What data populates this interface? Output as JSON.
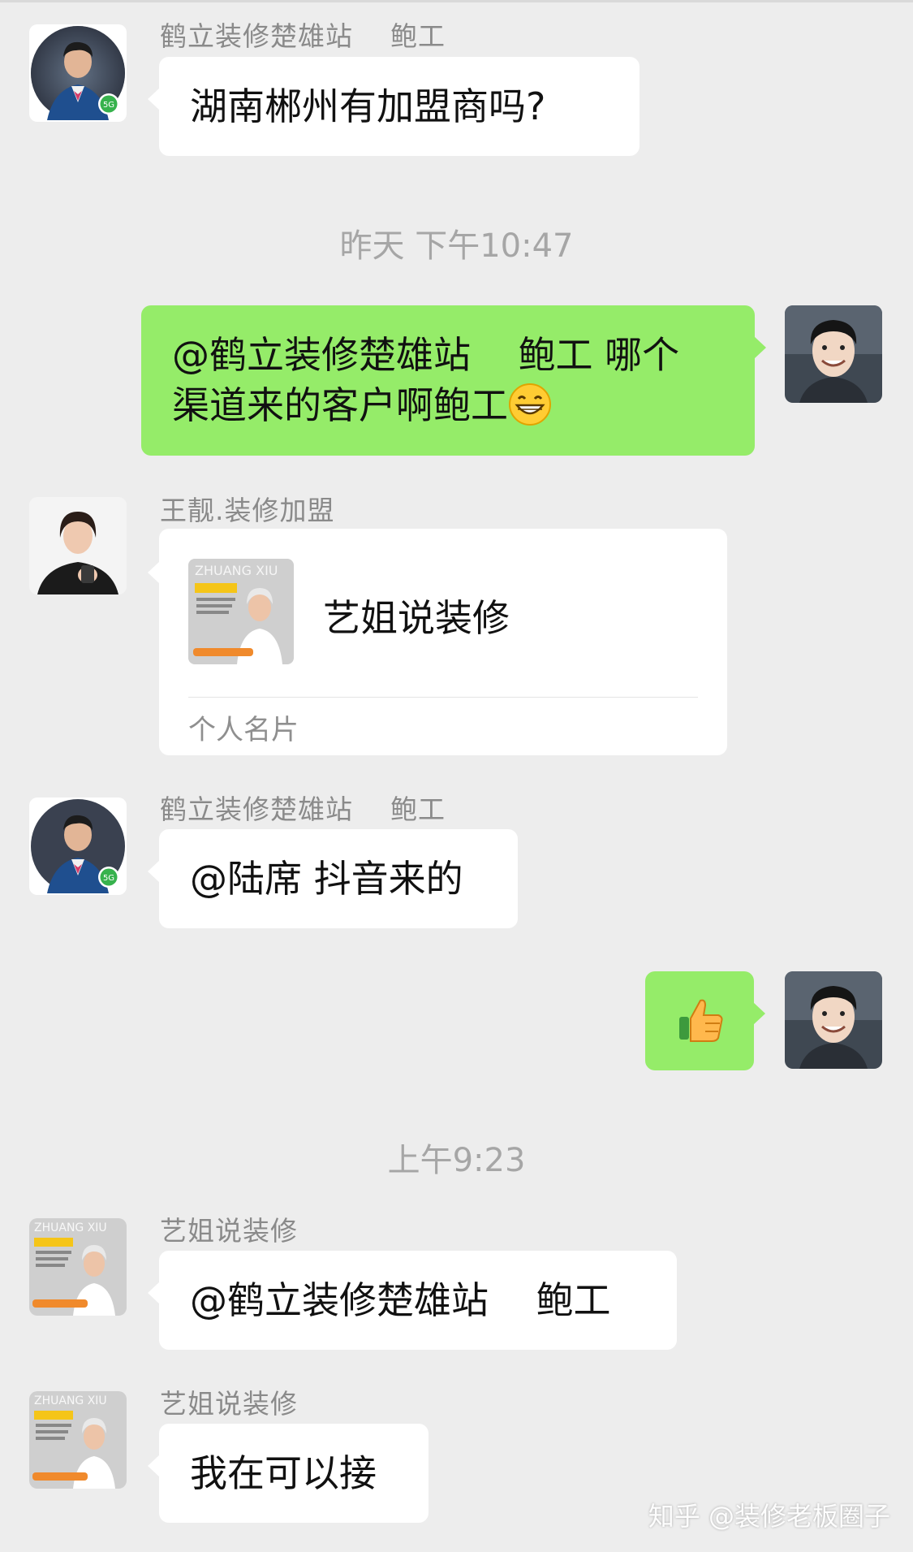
{
  "chat": {
    "messages": [
      {
        "sender": "鹤立装修楚雄站    鲍工",
        "text": "湖南郴州有加盟商吗?",
        "avatar_icon": "man-in-suit-avatar"
      },
      {
        "text_line1": "@鹤立装修楚雄站    鲍工 哪个",
        "text_line2": "渠道来的客户啊鲍工",
        "emoji_icon": "grinning-face-icon",
        "avatar_icon": "smiling-man-avatar"
      },
      {
        "sender": "王靓.装修加盟",
        "avatar_icon": "woman-avatar",
        "card": {
          "name": "艺姐说装修",
          "type": "个人名片",
          "thumb_icon": "contact-card-thumbnail"
        }
      },
      {
        "sender": "鹤立装修楚雄站    鲍工",
        "text": "@陆席 抖音来的",
        "avatar_icon": "man-in-suit-avatar"
      },
      {
        "emoji_icon": "thumbs-up-icon",
        "avatar_icon": "smiling-man-avatar"
      },
      {
        "sender": "艺姐说装修",
        "text": "@鹤立装修楚雄站    鲍工",
        "avatar_icon": "decoration-brand-avatar"
      },
      {
        "sender": "艺姐说装修",
        "text": "我在可以接",
        "avatar_icon": "decoration-brand-avatar"
      }
    ],
    "timestamps": [
      "昨天 下午10:47",
      "上午9:23"
    ]
  },
  "watermark": "知乎 @装修老板圈子",
  "colors": {
    "background": "#ededed",
    "incoming_bubble": "#ffffff",
    "outgoing_bubble": "#95ec69",
    "meta_text": "#8a8a8a"
  }
}
